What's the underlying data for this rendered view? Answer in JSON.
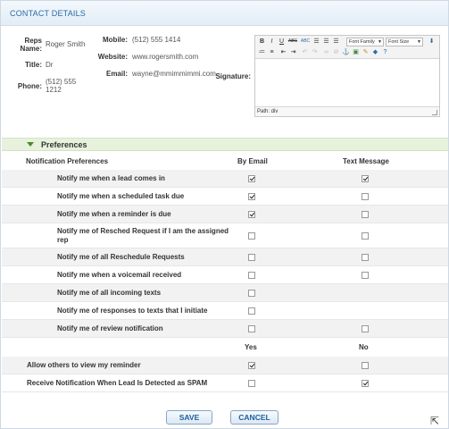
{
  "header": {
    "title": "CONTACT DETAILS"
  },
  "contact": {
    "reps_name_label": "Reps Name:",
    "reps_name": "Roger Smith",
    "title_label": "Title:",
    "title": "Dr",
    "phone_label": "Phone:",
    "phone_line1": "(512) 555",
    "phone_line2": "1212",
    "mobile_label": "Mobile:",
    "mobile": "(512) 555 1414",
    "website_label": "Website:",
    "website": "www.rogersmith.com",
    "email_label": "Email:",
    "email": "wayne@mmimmimmi.com",
    "signature_label": "Signature:"
  },
  "editor": {
    "font_family": "Font Family",
    "font_size": "Font Size",
    "path": "Path: div",
    "icons_row1": [
      "bold-icon",
      "italic-icon",
      "underline-icon",
      "strikethrough-icon",
      "align-left-icon",
      "align-center-icon",
      "align-right-icon"
    ],
    "icons_row2": [
      "bullet-list-icon",
      "numbered-list-icon",
      "outdent-icon",
      "indent-icon",
      "undo-icon",
      "redo-icon",
      "link-icon",
      "unlink-icon",
      "anchor-icon",
      "image-icon",
      "cleanup-icon",
      "help-icon"
    ]
  },
  "preferences": {
    "section_title": "Preferences",
    "col_notification": "Notification Preferences",
    "col_email": "By Email",
    "col_text": "Text Message",
    "rows": [
      {
        "label": "Notify me when a lead comes in",
        "email": true,
        "text": true
      },
      {
        "label": "Notify me when a scheduled task due",
        "email": true,
        "text": false
      },
      {
        "label": "Notify me when a reminder is due",
        "email": true,
        "text": false
      },
      {
        "label_line1": "Notify me of Resched Request if I am the assigned",
        "label_line2": "rep",
        "email": false,
        "text": false
      },
      {
        "label": "Notify me of all Reschedule Requests",
        "email": false,
        "text": false
      },
      {
        "label": "Notify me when a voicemail received",
        "email": false,
        "text": false
      },
      {
        "label": "Notify me of all incoming texts",
        "email": false,
        "text": null
      },
      {
        "label": "Notify me of responses to texts that I initiate",
        "email": false,
        "text": null
      },
      {
        "label": "Notify me of review notification",
        "email": false,
        "text": false
      }
    ],
    "yes_label": "Yes",
    "no_label": "No",
    "extra_rows": [
      {
        "label": "Allow others to view my reminder",
        "yes": true,
        "no": false
      },
      {
        "label": "Receive Notification When Lead Is Detected as SPAM",
        "yes": false,
        "no": true
      }
    ]
  },
  "buttons": {
    "save": "SAVE",
    "cancel": "CANCEL"
  }
}
